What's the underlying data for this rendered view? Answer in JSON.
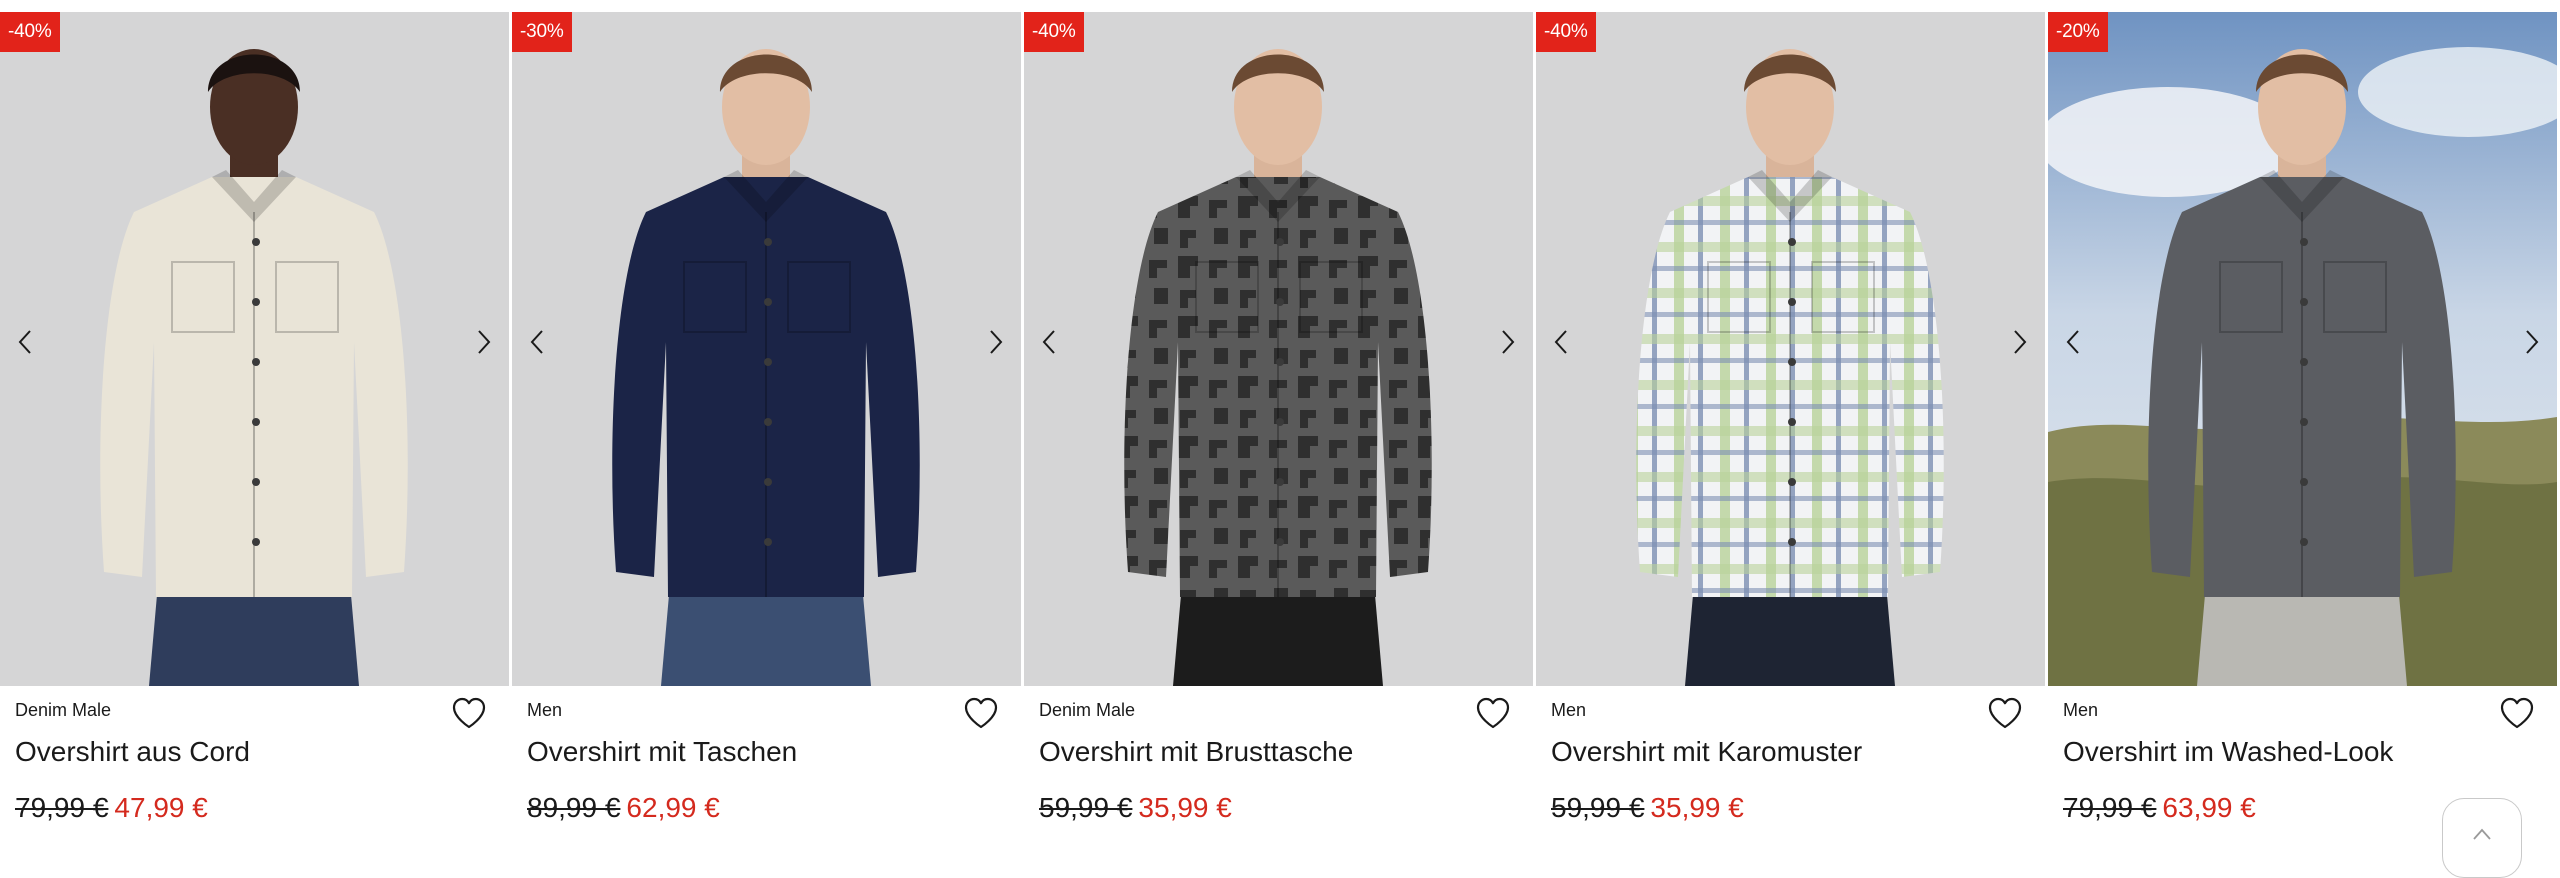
{
  "products": [
    {
      "badge": "-40%",
      "brand": "Denim Male",
      "title": "Overshirt aus Cord",
      "old_price": "79,99 €",
      "new_price": "47,99 €",
      "shirt_color": "#e9e4d7",
      "pants_color": "#2f3d5c",
      "pattern": "plain",
      "background": "studio"
    },
    {
      "badge": "-30%",
      "brand": "Men",
      "title": "Overshirt mit Taschen",
      "old_price": "89,99 €",
      "new_price": "62,99 €",
      "shirt_color": "#1b2447",
      "pants_color": "#3b4f72",
      "pattern": "plain",
      "background": "studio"
    },
    {
      "badge": "-40%",
      "brand": "Denim Male",
      "title": "Overshirt mit Brusttasche",
      "old_price": "59,99 €",
      "new_price": "35,99 €",
      "shirt_color": "#4b4b4b",
      "pants_color": "#1c1c1c",
      "pattern": "camo",
      "background": "studio"
    },
    {
      "badge": "-40%",
      "brand": "Men",
      "title": "Overshirt mit Karomuster",
      "old_price": "59,99 €",
      "new_price": "35,99 €",
      "shirt_color": "#eef0f2",
      "pants_color": "#1e2433",
      "pattern": "plaid",
      "background": "studio"
    },
    {
      "badge": "-20%",
      "brand": "Men",
      "title": "Overshirt im Washed-Look",
      "old_price": "79,99 €",
      "new_price": "63,99 €",
      "shirt_color": "#5b5d62",
      "pants_color": "#b9b8b3",
      "pattern": "plain",
      "background": "outdoor"
    }
  ],
  "icons": {
    "prev": "chevron-left-icon",
    "next": "chevron-right-icon",
    "wishlist": "heart-outline-icon",
    "scroll_top": "chevron-up-icon"
  },
  "colors": {
    "badge": "#e2231a",
    "sale_price": "#d42a1e",
    "text": "#1a1a1a",
    "image_background": "#d5d5d6"
  }
}
